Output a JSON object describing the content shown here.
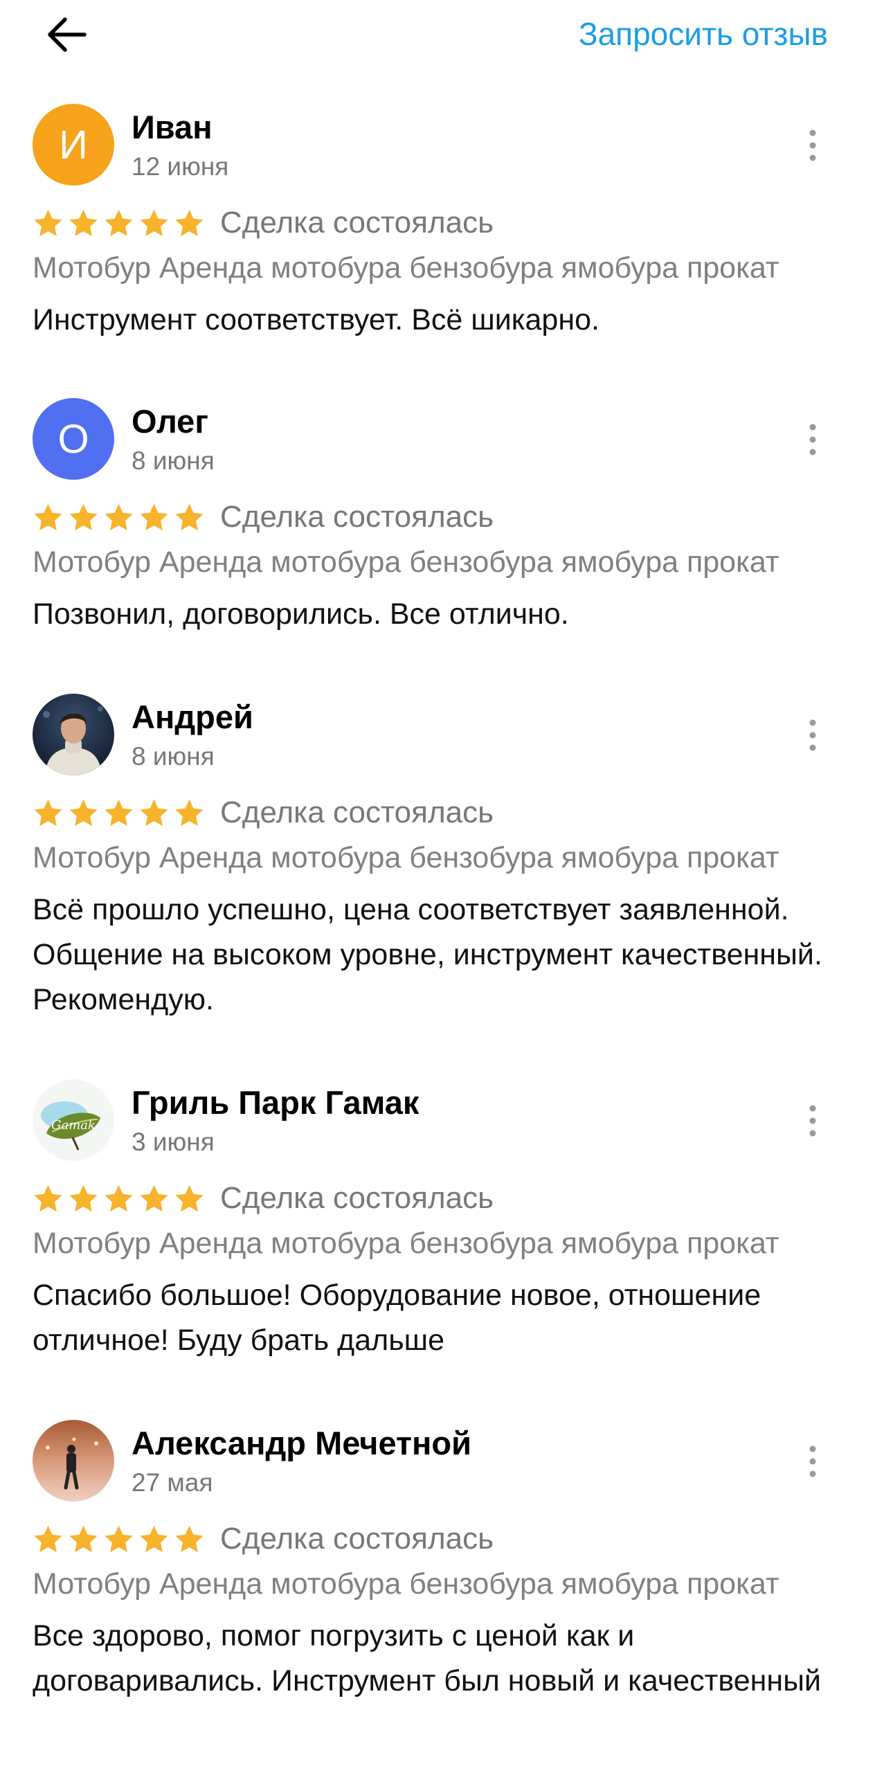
{
  "header": {
    "back_icon": "arrow-left-icon",
    "request_review_label": "Запросить отзыв"
  },
  "colors": {
    "accent": "#1a9ee6",
    "star": "#f7b32b",
    "secondary_text": "#777777"
  },
  "reviews": [
    {
      "author": "Иван",
      "date": "12 июня",
      "avatar": {
        "type": "initial",
        "letter": "И",
        "color": "#f6a21a"
      },
      "stars": 5,
      "status": "Сделка состоялась",
      "ad_title": "Мотобур Аренда мотобура бензобура ямобура прокат",
      "text": "Инструмент соответствует. Всё шикарно."
    },
    {
      "author": "Олег",
      "date": "8 июня",
      "avatar": {
        "type": "initial",
        "letter": "О",
        "color": "#4f6ff0"
      },
      "stars": 5,
      "status": "Сделка состоялась",
      "ad_title": "Мотобур Аренда мотобура бензобура ямобура прокат",
      "text": "Позвонил, договорились. Все отлично."
    },
    {
      "author": "Андрей",
      "date": "8 июня",
      "avatar": {
        "type": "photo"
      },
      "stars": 5,
      "status": "Сделка состоялась",
      "ad_title": "Мотобур Аренда мотобура бензобура ямобура прокат",
      "text": "Всё прошло успешно, цена соответствует заявленной. Общение на высоком уровне, инструмент качественный. Рекомендую."
    },
    {
      "author": "Гриль Парк Гамак",
      "date": "3 июня",
      "avatar": {
        "type": "logo",
        "logo_text": "Gamak"
      },
      "stars": 5,
      "status": "Сделка состоялась",
      "ad_title": "Мотобур Аренда мотобура бензобура ямобура прокат",
      "text": "Спасибо большое! Оборудование новое, отношение отличное! Буду брать дальше"
    },
    {
      "author": "Александр Мечетной",
      "date": "27 мая",
      "avatar": {
        "type": "photo"
      },
      "stars": 5,
      "status": "Сделка состоялась",
      "ad_title": "Мотобур Аренда мотобура бензобура ямобура прокат",
      "text": "Все здорово, помог погрузить с ценой как и договаривались. Инструмент был новый и качественный"
    }
  ]
}
